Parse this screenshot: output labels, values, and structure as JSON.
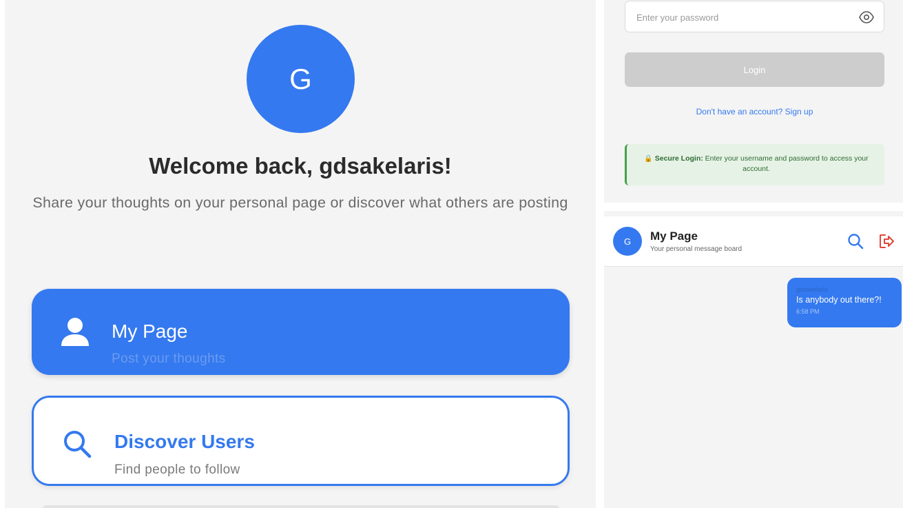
{
  "home": {
    "avatar_initial": "G",
    "welcome_title": "Welcome back, gdsakelaris!",
    "welcome_subtitle": "Share your thoughts on your personal page or discover what others are posting",
    "cards": [
      {
        "title": "My Page",
        "description": "Post your thoughts",
        "icon": "user-icon"
      },
      {
        "title": "Discover Users",
        "description": "Find people to follow",
        "icon": "search-icon"
      }
    ]
  },
  "login": {
    "password_placeholder": "Enter your password",
    "login_label": "Login",
    "signup_text": "Don't have an account? Sign up",
    "secure_note_label": "Secure Login:",
    "secure_note_text": "Enter your username and password to access your account.",
    "secure_note_icon": "lock-icon"
  },
  "mypage": {
    "avatar_initial": "G",
    "title": "My Page",
    "subtitle": "Your personal message board",
    "actions": [
      {
        "icon": "search-icon"
      },
      {
        "icon": "logout-icon"
      }
    ],
    "messages": [
      {
        "author": "gdsakelaris",
        "text": "Is anybody out there?!",
        "time": "6:58 PM"
      }
    ]
  },
  "colors": {
    "primary": "#3479ef",
    "background": "#f4f4f4",
    "disabled_button": "#cdcdcd",
    "secure_bg": "#e6f2e6",
    "secure_border": "#46a04a",
    "logout_red": "#e0463a"
  }
}
